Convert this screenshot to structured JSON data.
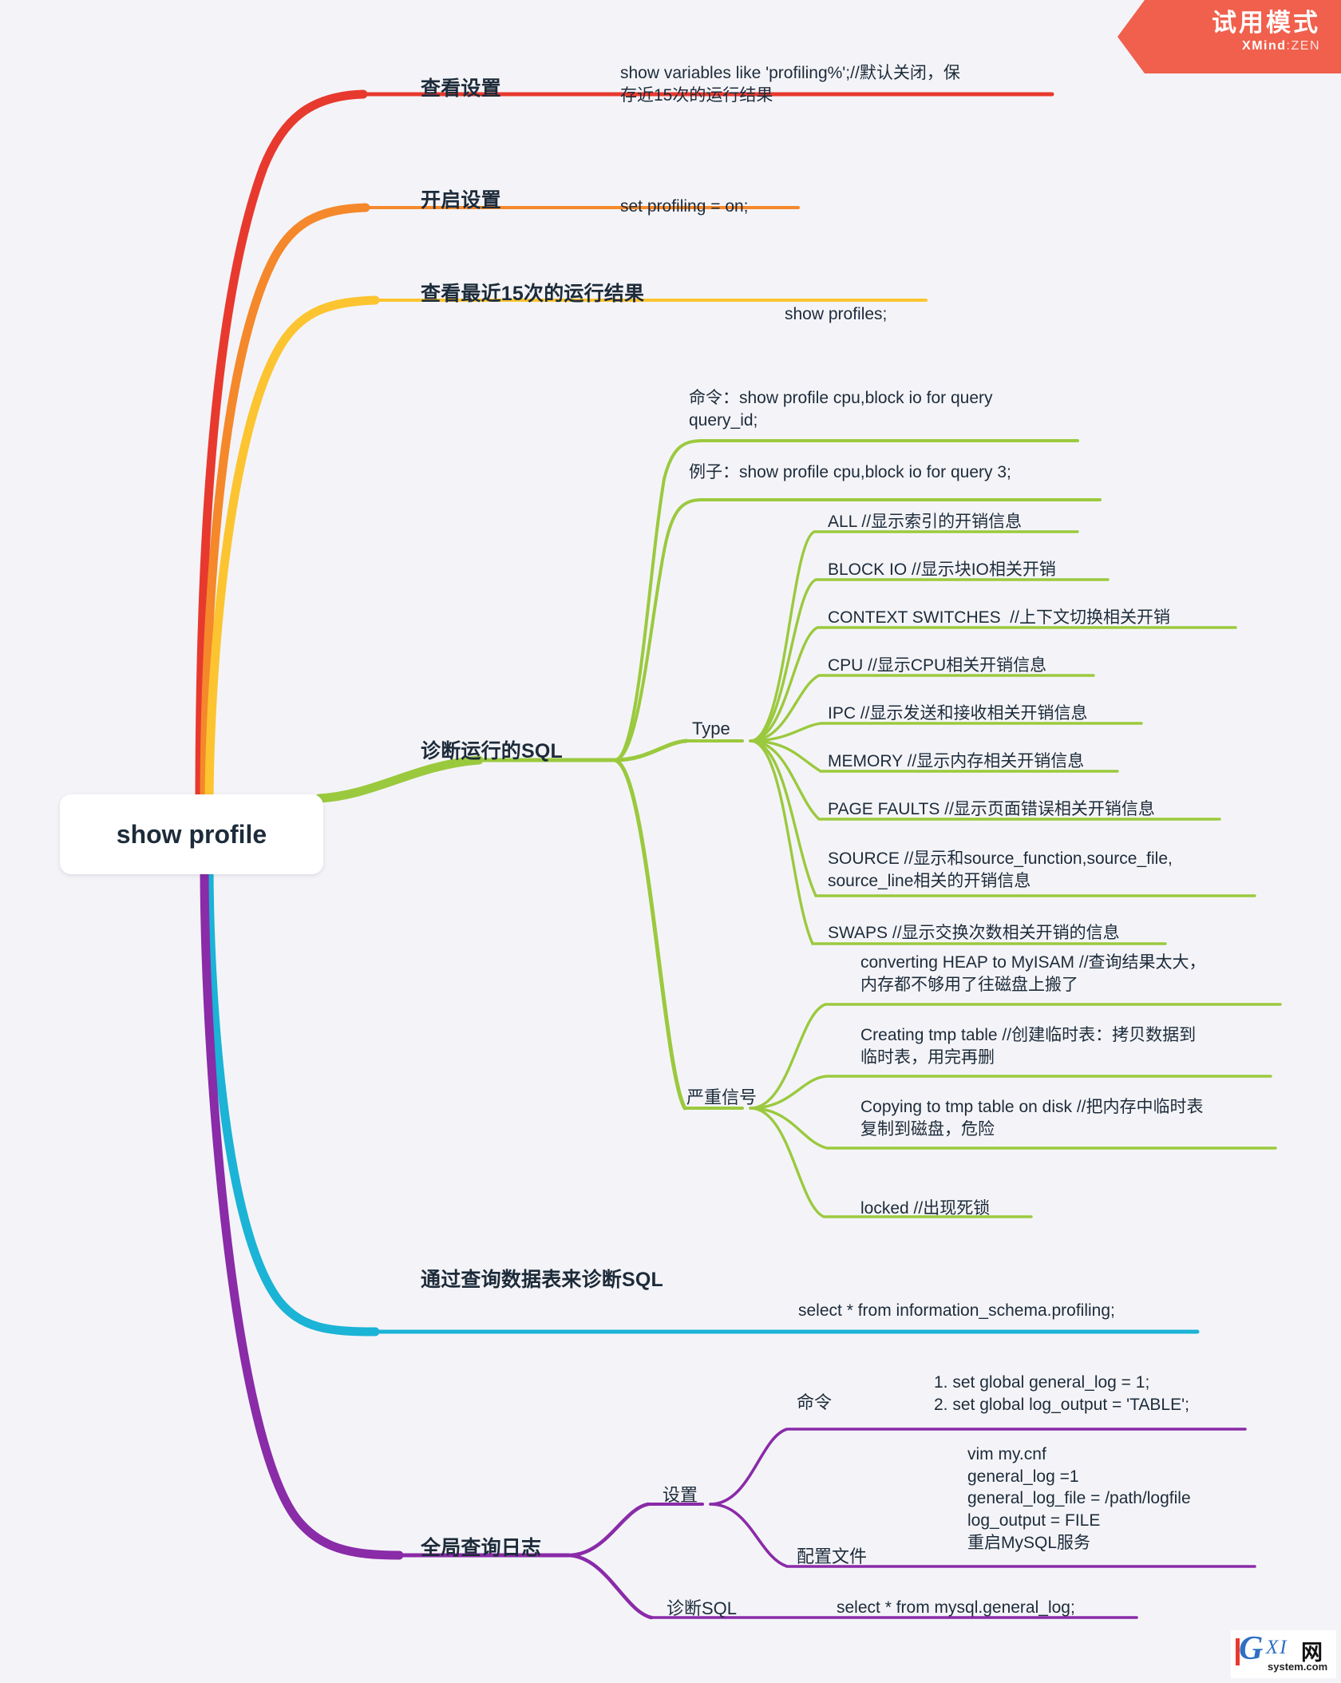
{
  "meta": {
    "background": "#f4f4f8",
    "text_color": "#1d2b3a"
  },
  "trial_badge": {
    "title": "试用模式",
    "product_bold": "XMind",
    "product_rest": ":ZEN",
    "color": "#f0604d"
  },
  "watermark": {
    "letter": "G",
    "mid": "XI",
    "cn": "网",
    "domain": "system.com"
  },
  "central": {
    "label": "show profile"
  },
  "colors": {
    "red": "#e8392e",
    "orange": "#f5882a",
    "yellow": "#fcc430",
    "green": "#9bc93e",
    "cyan": "#1bb3d6",
    "purple": "#8a2ba8"
  },
  "branches": [
    {
      "id": "view-setting",
      "label": "查看设置",
      "color": "#e8392e",
      "leaf": "show variables like 'profiling%';//默认关闭，保\n存近15次的运行结果"
    },
    {
      "id": "enable-setting",
      "label": "开启设置",
      "color": "#f5882a",
      "leaf": "set profiling = on;"
    },
    {
      "id": "recent-15",
      "label": "查看最近15次的运行结果",
      "color": "#fcc430",
      "leaf": "show profiles;"
    },
    {
      "id": "diagnose-sql",
      "label": "诊断运行的SQL",
      "color": "#9bc93e",
      "children": [
        {
          "id": "cmd",
          "label": "命令：show profile cpu,block io for query\nquery_id;"
        },
        {
          "id": "example",
          "label": "例子：show profile cpu,block io for query 3;"
        },
        {
          "id": "type",
          "label": "Type",
          "items": [
            "ALL //显示索引的开销信息",
            "BLOCK IO //显示块IO相关开销",
            "CONTEXT SWITCHES  //上下文切换相关开销",
            "CPU //显示CPU相关开销信息",
            "IPC //显示发送和接收相关开销信息",
            "MEMORY //显示内存相关开销信息",
            "PAGE FAULTS //显示页面错误相关开销信息",
            "SOURCE //显示和source_function,source_file,\nsource_line相关的开销信息",
            "SWAPS //显示交换次数相关开销的信息"
          ]
        },
        {
          "id": "severe-signal",
          "label": "严重信号",
          "items": [
            "converting HEAP to MyISAM  //查询结果太大，\n内存都不够用了往磁盘上搬了",
            "Creating tmp table //创建临时表：拷贝数据到\n临时表，用完再删",
            "Copying to tmp table on disk //把内存中临时表\n复制到磁盘，危险",
            "locked //出现死锁"
          ]
        }
      ]
    },
    {
      "id": "query-table-diagnose",
      "label": "通过查询数据表来诊断SQL",
      "color": "#1bb3d6",
      "leaf": "select * from information_schema.profiling;"
    },
    {
      "id": "global-query-log",
      "label": "全局查询日志",
      "color": "#8a2ba8",
      "children": [
        {
          "id": "settings",
          "label": "设置",
          "items": [
            {
              "id": "cmd",
              "label": "命令",
              "text": "1. set global general_log = 1;\n2. set global log_output = 'TABLE';"
            },
            {
              "id": "config-file",
              "label": "配置文件",
              "text": "vim my.cnf\ngeneral_log =1\ngeneral_log_file = /path/logfile\nlog_output = FILE\n重启MySQL服务"
            }
          ]
        },
        {
          "id": "diagnose-sql",
          "label": "诊断SQL",
          "text": "select * from mysql.general_log;"
        }
      ]
    }
  ]
}
